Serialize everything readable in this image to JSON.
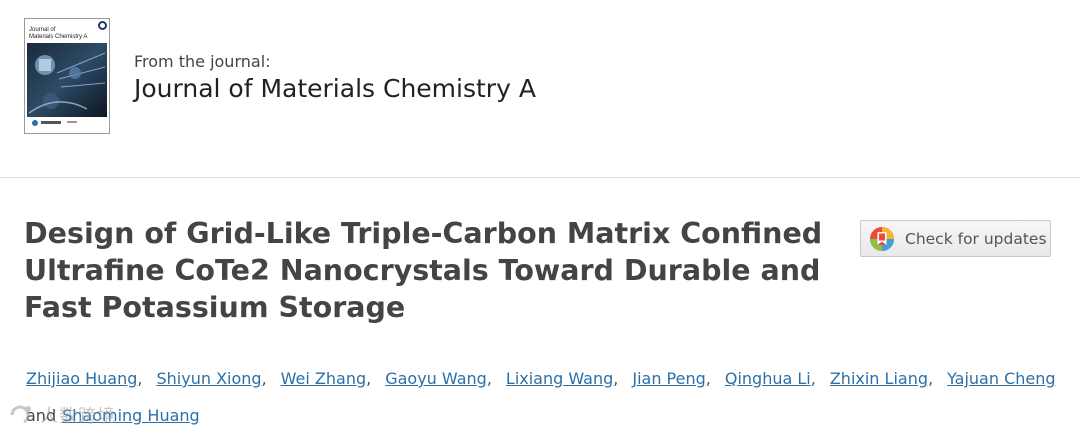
{
  "journal": {
    "cover_title_line1": "Journal of",
    "cover_title_line2": "Materials Chemistry A",
    "from_label": "From the journal:",
    "name": "Journal of Materials Chemistry A"
  },
  "article": {
    "title": "Design of Grid-Like Triple-Carbon Matrix Confined Ultrafine CoTe2 Nanocrystals Toward Durable and Fast Potassium Storage"
  },
  "check_updates": {
    "label": "Check for updates",
    "icon": "crossmark-icon"
  },
  "authors": {
    "list": [
      "Zhijiao Huang",
      "Shiyun Xiong",
      "Wei Zhang",
      "Gaoyu Wang",
      "Lixiang Wang",
      "Jian Peng",
      "Qinghua Li",
      "Zhixin Liang",
      "Yajuan Cheng"
    ],
    "separator": ",",
    "and_word": "and",
    "last": "Shaoming Huang"
  },
  "watermark": {
    "text": "人数跨境"
  },
  "colors": {
    "link": "#2b70a8",
    "title": "#444444",
    "divider": "#e2e2e2"
  }
}
